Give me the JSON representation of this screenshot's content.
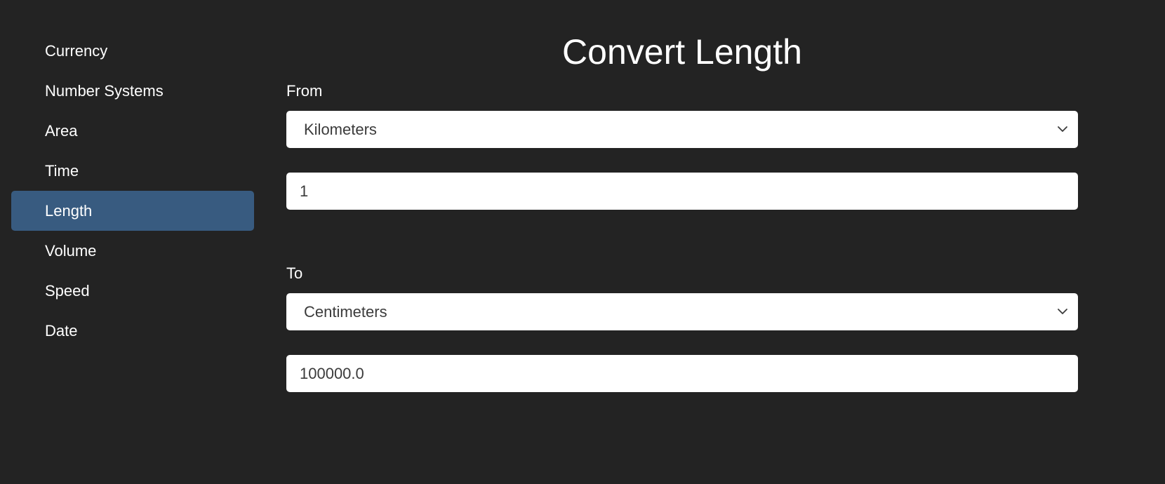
{
  "sidebar": {
    "items": [
      {
        "label": "Currency",
        "active": false
      },
      {
        "label": "Number Systems",
        "active": false
      },
      {
        "label": "Area",
        "active": false
      },
      {
        "label": "Time",
        "active": false
      },
      {
        "label": "Length",
        "active": true
      },
      {
        "label": "Volume",
        "active": false
      },
      {
        "label": "Speed",
        "active": false
      },
      {
        "label": "Date",
        "active": false
      }
    ]
  },
  "main": {
    "title": "Convert Length",
    "from": {
      "label": "From",
      "unit": "Kilometers",
      "value": "1"
    },
    "to": {
      "label": "To",
      "unit": "Centimeters",
      "value": "100000.0"
    }
  },
  "colors": {
    "background": "#232323",
    "active_nav": "#385b80",
    "input_bg": "#ffffff",
    "input_text": "#3b3b3b"
  },
  "icons": {
    "select_arrow": "chevron-down-icon"
  }
}
